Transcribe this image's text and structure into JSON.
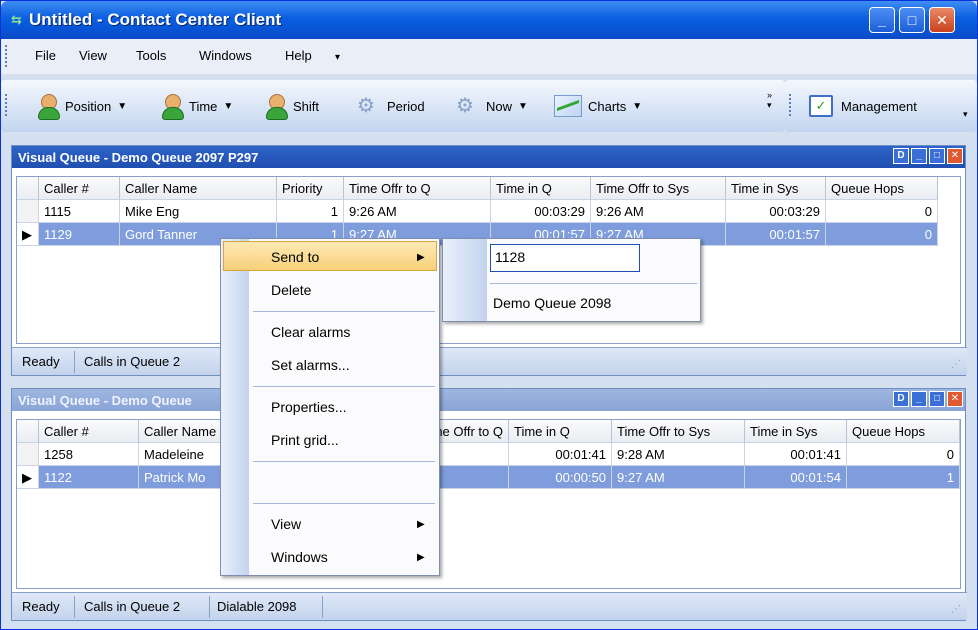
{
  "window": {
    "title": "Untitled - Contact Center Client"
  },
  "menubar": {
    "items": [
      "File",
      "View",
      "Tools",
      "Windows",
      "Help"
    ]
  },
  "toolbar": {
    "position": "Position",
    "time": "Time",
    "shift": "Shift",
    "period": "Period",
    "now": "Now",
    "charts": "Charts",
    "management": "Management"
  },
  "queue1": {
    "title": "Visual Queue - Demo Queue 2097 P297",
    "columns": [
      "Caller #",
      "Caller Name",
      "Priority",
      "Time Offr to Q",
      "Time in Q",
      "Time Offr to Sys",
      "Time in Sys",
      "Queue Hops"
    ],
    "rows": [
      {
        "caller": "1115",
        "name": "Mike Eng",
        "priority": "1",
        "offr_q": "9:26 AM",
        "in_q": "00:03:29",
        "offr_sys": "9:26 AM",
        "in_sys": "00:03:29",
        "hops": "0"
      },
      {
        "caller": "1129",
        "name": "Gord Tanner",
        "priority": "1",
        "offr_q": "9:27 AM",
        "in_q": "00:01:57",
        "offr_sys": "9:27 AM",
        "in_sys": "00:01:57",
        "hops": "0"
      }
    ],
    "status": {
      "ready": "Ready",
      "calls": "Calls in Queue 2"
    }
  },
  "queue2": {
    "title": "Visual Queue - Demo Queue",
    "columns": [
      "Caller #",
      "Caller Name",
      "Time Offr to Q",
      "Time in Q",
      "Time Offr to Sys",
      "Time in Sys",
      "Queue Hops"
    ],
    "rows": [
      {
        "caller": "1258",
        "name": "Madeleine",
        "in_q": "00:01:41",
        "offr_sys": "9:28 AM",
        "in_sys": "00:01:41",
        "hops": "0"
      },
      {
        "caller": "1122",
        "name": "Patrick Mo",
        "in_q": "00:00:50",
        "offr_sys": "9:27 AM",
        "in_sys": "00:01:54",
        "hops": "1"
      }
    ],
    "status": {
      "ready": "Ready",
      "calls": "Calls in Queue 2",
      "dialable": "Dialable 2098"
    }
  },
  "context_menu": {
    "send_to": "Send to",
    "delete": "Delete",
    "clear_alarms": "Clear alarms",
    "set_alarms": "Set alarms...",
    "properties": "Properties...",
    "print_grid": "Print grid...",
    "view": "View",
    "windows": "Windows"
  },
  "submenu": {
    "input_value": "1128",
    "item": "Demo Queue 2098"
  }
}
